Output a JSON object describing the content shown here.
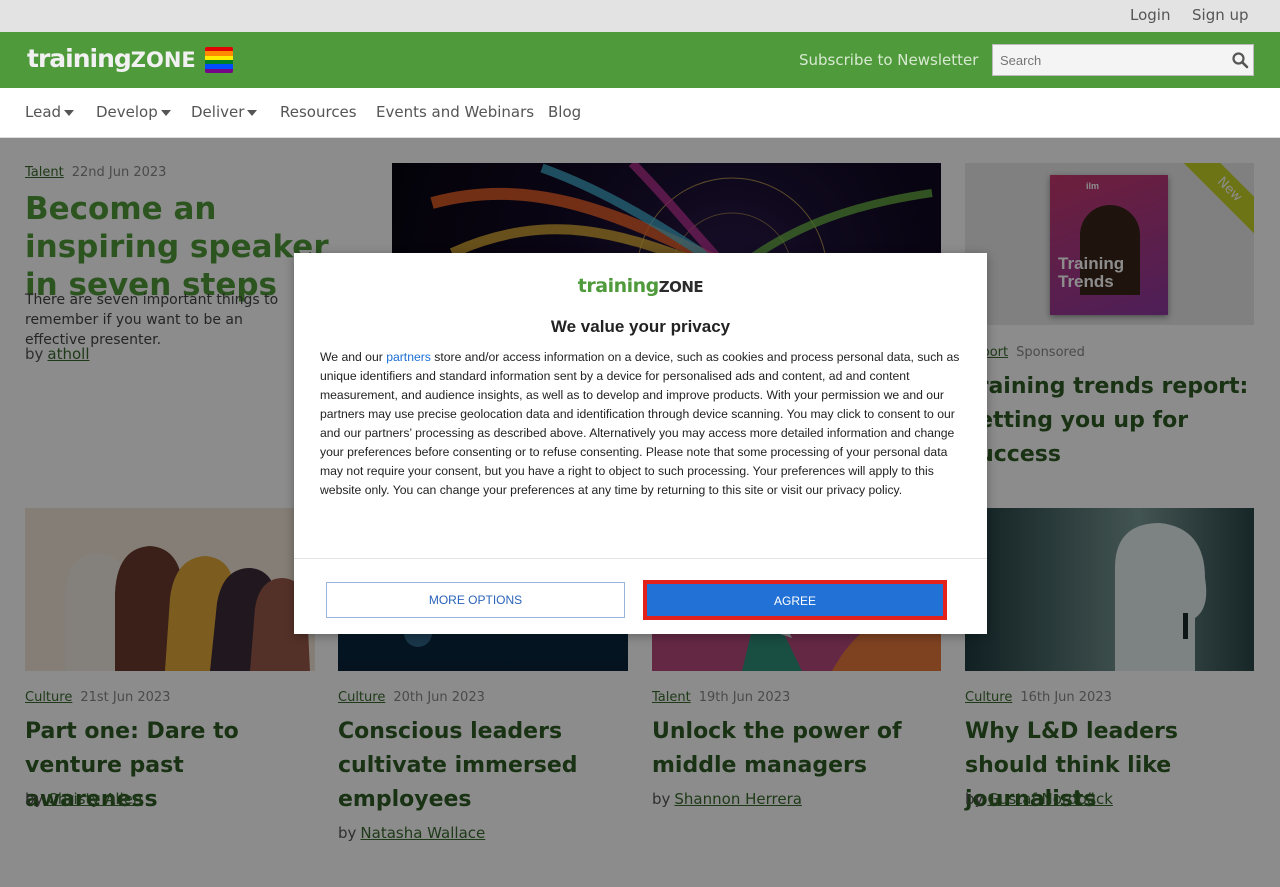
{
  "topbar": {
    "login": "Login",
    "signup": "Sign up"
  },
  "header": {
    "logo_main": "training",
    "logo_zone": "ZONE",
    "subscribe": "Subscribe to Newsletter",
    "search_placeholder": "Search"
  },
  "nav": {
    "lead": "Lead",
    "develop": "Develop",
    "deliver": "Deliver",
    "resources": "Resources",
    "events": "Events and Webinars",
    "blog": "Blog"
  },
  "hero": {
    "category": "Talent",
    "date": "22nd Jun 2023",
    "title": "Become an inspiring speaker in seven steps",
    "excerpt": "There are seven important things to remember if you want to be an effective presenter.",
    "by": "by",
    "author": "atholl"
  },
  "sponsored": {
    "badge": "New",
    "cover_brand": "ilm",
    "cover_title_1": "Training",
    "cover_title_2": "Trends",
    "category": "Report",
    "sponsored_label": "Sponsored",
    "title": "Training trends report: setting you up for success"
  },
  "cards": [
    {
      "category": "Culture",
      "date": "21st Jun 2023",
      "title": "Part one: Dare to venture past awareness",
      "by": "by",
      "author": "Christy Allen"
    },
    {
      "category": "Culture",
      "date": "20th Jun 2023",
      "title": "Conscious leaders cultivate immersed employees",
      "by": "by",
      "author": "Natasha Wallace"
    },
    {
      "category": "Talent",
      "date": "19th Jun 2023",
      "title": "Unlock the power of middle managers",
      "by": "by",
      "author": "Shannon Herrera"
    },
    {
      "category": "Culture",
      "date": "16th Jun 2023",
      "title": "Why L&D leaders should think like journalists",
      "by": "by",
      "author": "Gustaf Nordbäck"
    }
  ],
  "consent": {
    "logo_main": "training",
    "logo_zone": "ZONE",
    "title": "We value your privacy",
    "text_before": "We and our",
    "partners_link": "partners",
    "text_after": "store and/or access information on a device, such as cookies and process personal data, such as unique identifiers and standard information sent by a device for personalised ads and content, ad and content measurement, and audience insights, as well as to develop and improve products. With your permission we and our partners may use precise geolocation data and identification through device scanning. You may click to consent to our and our partners’ processing as described above. Alternatively you may access more detailed information and change your preferences before consenting or to refuse consenting. Please note that some processing of your personal data may not require your consent, but you have a right to object to such processing. Your preferences will apply to this website only. You can change your preferences at any time by returning to this site or visit our privacy policy.",
    "more_options": "MORE OPTIONS",
    "agree": "AGREE"
  },
  "colors": {
    "brand_green": "#4f9a3a",
    "dark_green": "#2e5c24",
    "agree_blue": "#2271d6",
    "highlight_red": "#e5211c"
  }
}
